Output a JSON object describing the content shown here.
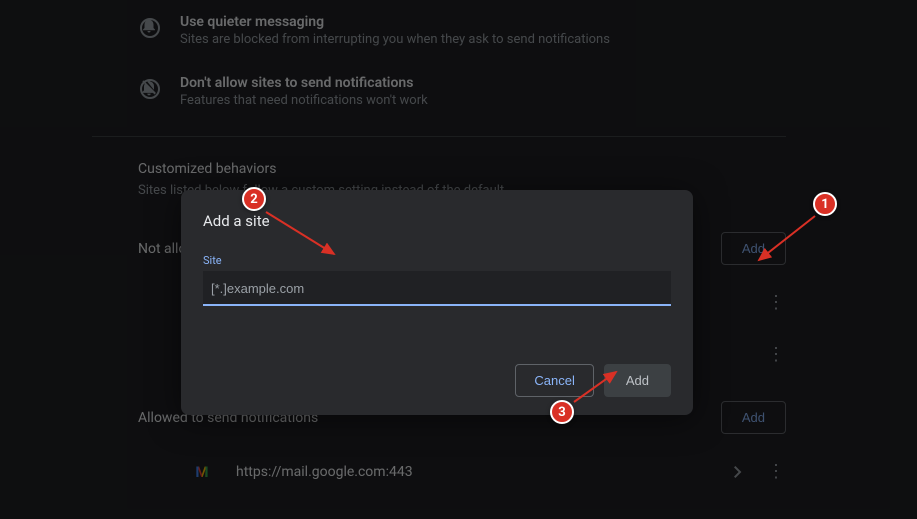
{
  "options": {
    "quieter": {
      "title": "Use quieter messaging",
      "subtitle": "Sites are blocked from interrupting you when they ask to send notifications"
    },
    "block": {
      "title": "Don't allow sites to send notifications",
      "subtitle": "Features that need notifications won't work"
    }
  },
  "customized": {
    "heading": "Customized behaviors",
    "sub": "Sites listed below follow a custom setting instead of the default"
  },
  "notAllowed": {
    "label": "Not allowed to send notifications",
    "addLabel": "Add"
  },
  "allowed": {
    "label": "Allowed to send notifications",
    "addLabel": "Add",
    "items": [
      {
        "url": "https://mail.google.com:443"
      }
    ]
  },
  "dialog": {
    "title": "Add a site",
    "fieldLabel": "Site",
    "placeholder": "[*.]example.com",
    "value": "",
    "cancel": "Cancel",
    "add": "Add"
  },
  "annotations": {
    "c1": "1",
    "c2": "2",
    "c3": "3"
  }
}
